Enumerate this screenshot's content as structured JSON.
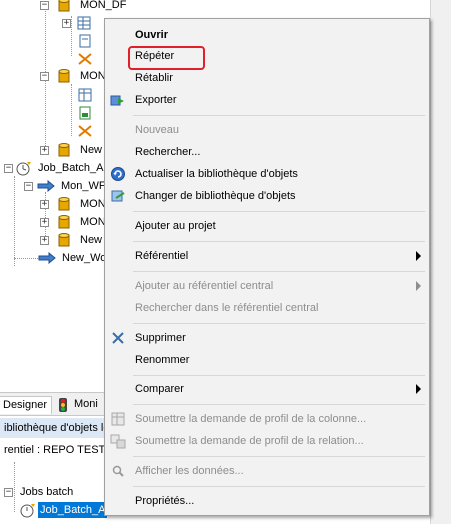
{
  "tree": {
    "nodes": [
      {
        "label": "MON_DF"
      },
      {
        "label": "MON"
      },
      {
        "label": "New"
      },
      {
        "label": "Job_Batch_A"
      },
      {
        "label": "Mon_WF"
      },
      {
        "label": "MON"
      },
      {
        "label": "MON"
      },
      {
        "label": "New"
      },
      {
        "label": "New_Wo"
      }
    ]
  },
  "tabs": {
    "designer": "Designer",
    "monitor": "Moni"
  },
  "library_bar": "ibliothèque d'objets lo",
  "repository": "rentiel : REPO TEST",
  "lower": {
    "jobs_batch": "Jobs batch",
    "selected": "Job_Batch_A"
  },
  "menu": {
    "items": [
      {
        "label": "Ouvrir"
      },
      {
        "label": "Répéter"
      },
      {
        "label": "Rétablir"
      },
      {
        "label": "Exporter"
      },
      {
        "label": "Nouveau"
      },
      {
        "label": "Rechercher..."
      },
      {
        "label": "Actualiser la bibliothèque d'objets"
      },
      {
        "label": "Changer de bibliothèque d'objets"
      },
      {
        "label": "Ajouter au projet"
      },
      {
        "label": "Référentiel"
      },
      {
        "label": "Ajouter au référentiel central"
      },
      {
        "label": "Rechercher dans le référentiel central"
      },
      {
        "label": "Supprimer"
      },
      {
        "label": "Renommer"
      },
      {
        "label": "Comparer"
      },
      {
        "label": "Soumettre la demande de profil de la colonne..."
      },
      {
        "label": "Soumettre la demande de profil de la relation..."
      },
      {
        "label": "Afficher les données..."
      },
      {
        "label": "Propriétés..."
      }
    ]
  },
  "colors": {
    "highlight": "#e0202a",
    "selection": "#0078d7",
    "menu_bg": "#f2f2f2"
  }
}
